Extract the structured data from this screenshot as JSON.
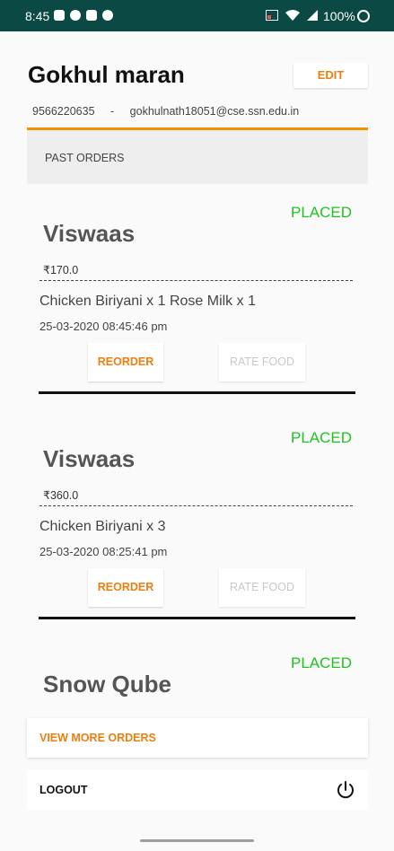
{
  "status_bar": {
    "time": "8:45",
    "battery": "100%"
  },
  "profile": {
    "name": "Gokhul maran",
    "edit_label": "EDIT",
    "phone": "9566220635",
    "separator": "-",
    "email": "gokhulnath18051@cse.ssn.edu.in"
  },
  "section_title": "PAST ORDERS",
  "orders": [
    {
      "status": "PLACED",
      "restaurant": "Viswaas",
      "price": "₹170.0",
      "items": "Chicken Biriyani x 1   Rose Milk x 1",
      "datetime": "25-03-2020    08:45:46 pm",
      "reorder_label": "REORDER",
      "rate_label": "RATE FOOD"
    },
    {
      "status": "PLACED",
      "restaurant": "Viswaas",
      "price": "₹360.0",
      "items": "Chicken Biriyani x 3",
      "datetime": "25-03-2020    08:25:41 pm",
      "reorder_label": "REORDER",
      "rate_label": "RATE FOOD"
    },
    {
      "status": "PLACED",
      "restaurant": "Snow Qube"
    }
  ],
  "view_more_label": "VIEW MORE ORDERS",
  "logout_label": "LOGOUT",
  "colors": {
    "status_bar": "#0b4a44",
    "accent": "#ef7e0f",
    "placed": "#1ec41e",
    "divider": "#f39200"
  },
  "icons": {
    "status_left": [
      "message-icon",
      "whatsapp-icon",
      "gallery-icon",
      "record-icon"
    ],
    "status_right": [
      "cast-icon",
      "wifi-icon",
      "signal-icon",
      "battery-icon"
    ],
    "logout": "power-icon"
  }
}
